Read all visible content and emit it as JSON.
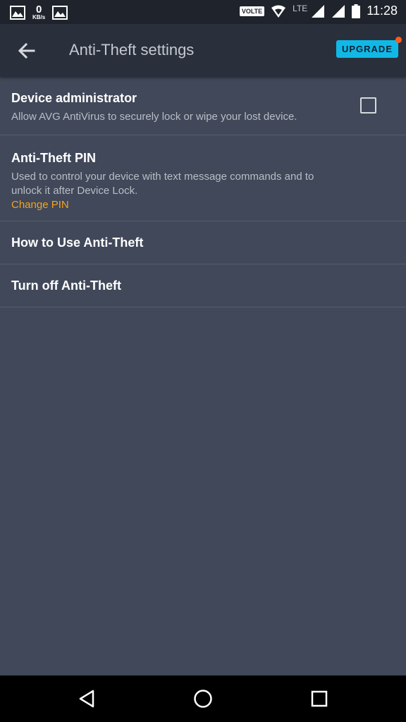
{
  "status_bar": {
    "net_speed_value": "0",
    "net_speed_unit": "KB/s",
    "volte": "VOLTE",
    "network": "LTE",
    "time": "11:28"
  },
  "app_bar": {
    "title": "Anti-Theft settings",
    "upgrade_label": "UPGRADE",
    "accent_color": "#11b8e6",
    "badge_color": "#ff5a1f"
  },
  "settings": {
    "device_admin": {
      "title": "Device administrator",
      "description": "Allow AVG AntiVirus to securely lock or wipe your lost device.",
      "checked": false
    },
    "pin": {
      "title": "Anti-Theft PIN",
      "description": "Used to control your device with text message commands and to unlock it after Device Lock.",
      "link": "Change PIN",
      "link_color": "#f7a21c"
    },
    "how_to": {
      "title": "How to Use Anti-Theft"
    },
    "turn_off": {
      "title": "Turn off Anti-Theft"
    }
  },
  "nav": {
    "icons": [
      "back-triangle-icon",
      "home-circle-icon",
      "recents-square-icon"
    ]
  }
}
